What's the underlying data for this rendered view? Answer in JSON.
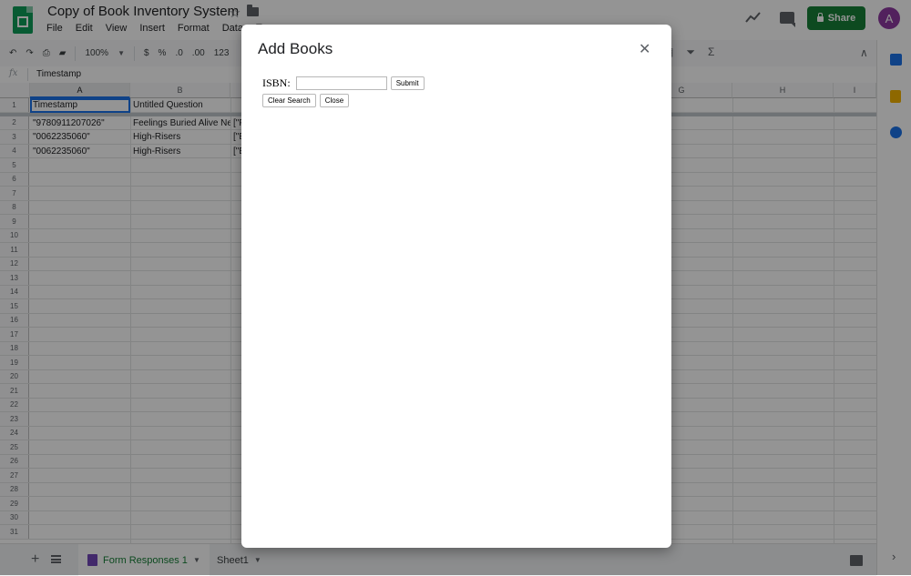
{
  "app": {
    "doc_title": "Copy of Book Inventory System",
    "menu": [
      "File",
      "Edit",
      "View",
      "Insert",
      "Format",
      "Data",
      "To"
    ],
    "share_label": "Share",
    "avatar_letter": "A"
  },
  "toolbar": {
    "zoom": "100%",
    "currency": "$",
    "percent": "%",
    "decimal_less": ".0",
    "decimal_more": ".00",
    "format_more": "123"
  },
  "formula_bar": {
    "fx": "fx",
    "value": "Timestamp"
  },
  "grid": {
    "columns": [
      "A",
      "B",
      "G",
      "H",
      "I"
    ],
    "row_numbers": [
      "1",
      "2",
      "3",
      "4",
      "5",
      "6",
      "7",
      "8",
      "9",
      "10",
      "11",
      "12",
      "13",
      "14",
      "15",
      "16",
      "17",
      "18",
      "19",
      "20",
      "21",
      "22",
      "23",
      "24",
      "25",
      "26",
      "27",
      "28",
      "29",
      "30",
      "31"
    ],
    "rows": [
      [
        "Timestamp",
        "Untitled Question",
        ""
      ],
      [
        "\"9780911207026\"",
        "Feelings Buried Alive Nev",
        "[\"F"
      ],
      [
        "\"0062235060\"",
        "High-Risers",
        "[\"E"
      ],
      [
        "\"0062235060\"",
        "High-Risers",
        "[\"E"
      ]
    ]
  },
  "sheets": {
    "tabs": [
      "Form Responses 1",
      "Sheet1"
    ]
  },
  "dialog": {
    "title": "Add Books",
    "isbn_label": "ISBN:",
    "isbn_value": "",
    "submit_label": "Submit",
    "clear_label": "Clear Search",
    "close_label": "Close"
  },
  "colors": {
    "brand_green": "#0f9d58",
    "share_green": "#188038",
    "avatar_purple": "#8e3aa0",
    "selection_blue": "#1a73e8"
  }
}
